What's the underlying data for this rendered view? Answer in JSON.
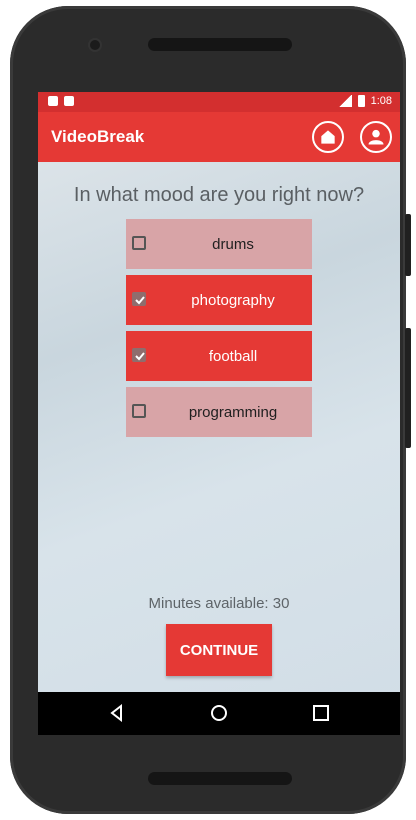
{
  "status_bar": {
    "time": "1:08",
    "icons": [
      "sd-card-icon",
      "photo-icon",
      "lte-signal-icon",
      "battery-icon"
    ]
  },
  "app_bar": {
    "title": "VideoBreak",
    "actions": [
      "home-icon",
      "profile-icon"
    ]
  },
  "question": "In what mood are you right now?",
  "options": [
    {
      "label": "drums",
      "checked": false
    },
    {
      "label": "photography",
      "checked": true
    },
    {
      "label": "football",
      "checked": true
    },
    {
      "label": "programming",
      "checked": false
    }
  ],
  "minutes_available": "Minutes available: 30",
  "continue_label": "CONTINUE",
  "navigation": [
    "back-icon",
    "home-nav-icon",
    "recents-icon"
  ],
  "colors": {
    "primary": "#e53935",
    "status_bar": "#d32f2f",
    "option_unchecked": "#d8a4a7",
    "background": "#d4dee5"
  }
}
